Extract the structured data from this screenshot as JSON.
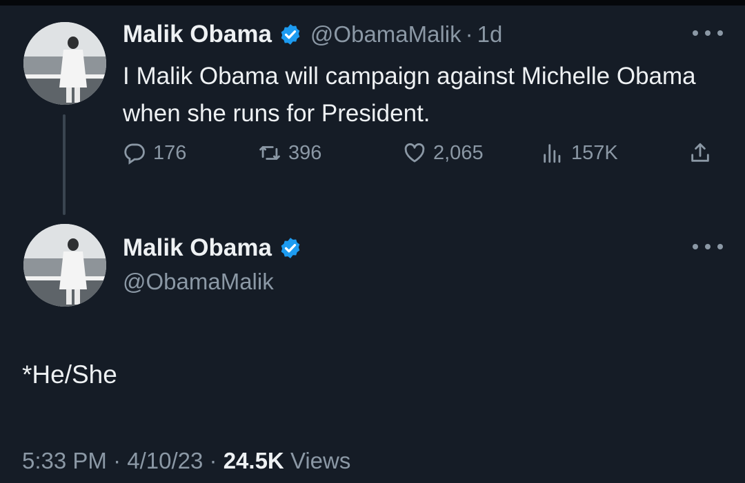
{
  "tweet": {
    "author_name": "Malik Obama",
    "author_handle": "@ObamaMalik",
    "separator": "·",
    "time_ago": "1d",
    "text": "I Malik Obama will campaign against Michelle Obama when she runs for President.",
    "replies": "176",
    "retweets": "396",
    "likes": "2,065",
    "views": "157K"
  },
  "reply": {
    "author_name": "Malik Obama",
    "author_handle": "@ObamaMalik",
    "text": "*He/She",
    "time": "5:33 PM",
    "separator": "·",
    "date": "4/10/23",
    "views_count": "24.5K",
    "views_label": "Views"
  },
  "colors": {
    "background": "#151c26",
    "verified_badge": "#1d9bf0",
    "muted_text": "#8b98a5",
    "primary_text": "#eef1f3"
  },
  "icons": {
    "verified": "verified-badge-icon",
    "more": "more-options-icon",
    "reply": "reply-icon",
    "retweet": "retweet-icon",
    "like": "heart-icon",
    "views": "views-chart-icon",
    "share": "share-icon"
  }
}
